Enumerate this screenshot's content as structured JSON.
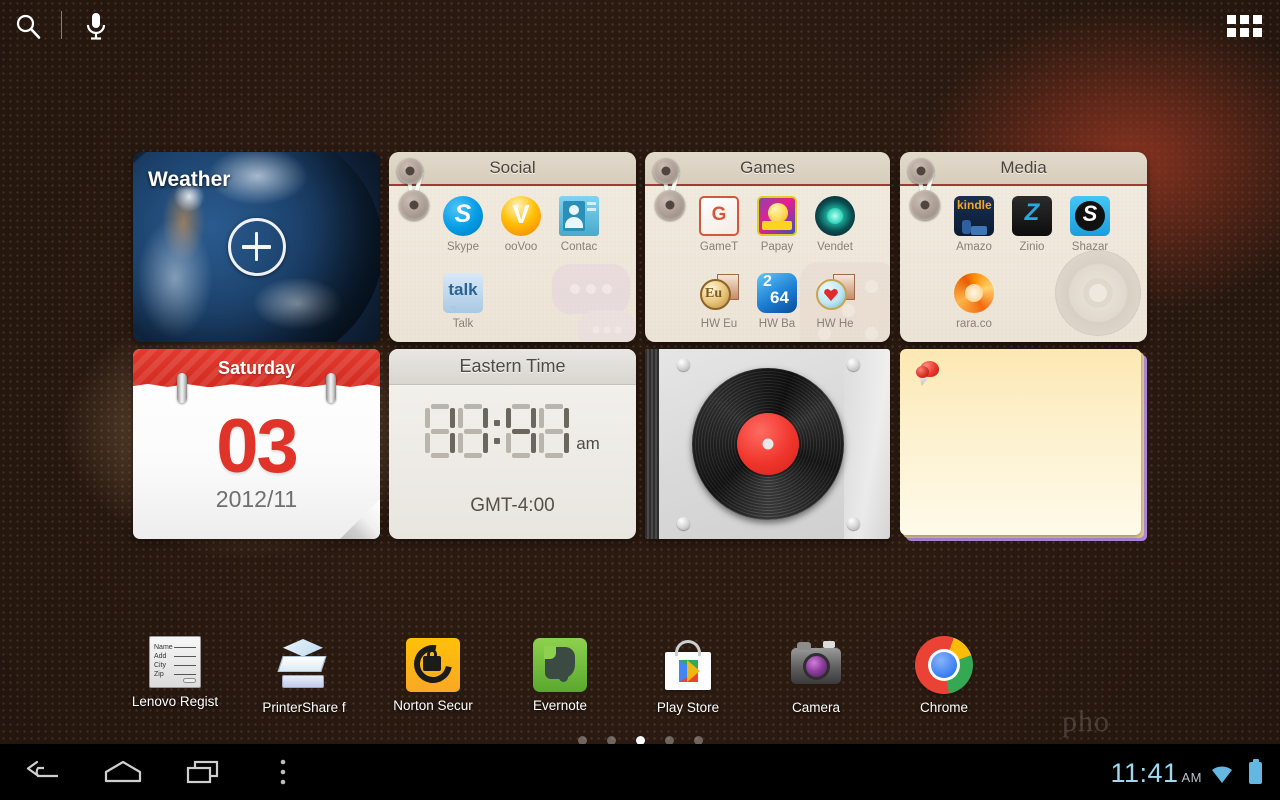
{
  "topbar": {
    "search_icon": "search-icon",
    "mic_icon": "microphone-icon",
    "apps_icon": "apps-grid-icon"
  },
  "widgets": {
    "weather": {
      "title": "Weather",
      "add_icon": "plus-circle-icon"
    },
    "social": {
      "title": "Social",
      "apps": [
        {
          "label": "Skype",
          "icon": "skype-icon"
        },
        {
          "label": "ooVoo",
          "icon": "oovoo-icon"
        },
        {
          "label": "Contac",
          "icon": "contacts-icon"
        },
        {
          "label": "Talk",
          "icon": "google-talk-icon"
        }
      ]
    },
    "games": {
      "title": "Games",
      "apps": [
        {
          "label": "GameT",
          "icon": "gameloft-box-icon"
        },
        {
          "label": "Papay",
          "icon": "papaya-icon"
        },
        {
          "label": "Vendet",
          "icon": "vendetta-icon"
        },
        {
          "label": "HW Eu",
          "icon": "hardwood-euchre-icon"
        },
        {
          "label": "HW Ba",
          "icon": "hardwood-backgammon-icon"
        },
        {
          "label": "HW He",
          "icon": "hardwood-hearts-icon"
        }
      ]
    },
    "media": {
      "title": "Media",
      "apps": [
        {
          "label": "Amazo",
          "icon": "kindle-icon"
        },
        {
          "label": "Zinio",
          "icon": "zinio-icon"
        },
        {
          "label": "Shazar",
          "icon": "shazam-icon"
        },
        {
          "label": "rara.co",
          "icon": "rara-icon"
        }
      ]
    },
    "calendar": {
      "weekday": "Saturday",
      "day": "03",
      "year_month": "2012/11"
    },
    "clock": {
      "zone_label": "Eastern Time",
      "time": "11:41",
      "meridiem": "am",
      "gmt_offset": "GMT-4:00",
      "digits": [
        "1",
        "1",
        "4",
        "1"
      ]
    },
    "music": {
      "name": "vinyl-record-widget"
    },
    "note": {
      "name": "sticky-note-widget",
      "text": ""
    }
  },
  "dock": [
    {
      "label": "Lenovo Regist",
      "icon": "lenovo-registration-icon"
    },
    {
      "label": "PrinterShare f",
      "icon": "printershare-icon"
    },
    {
      "label": "Norton Secur",
      "icon": "norton-security-icon"
    },
    {
      "label": "Evernote",
      "icon": "evernote-icon"
    },
    {
      "label": "Play Store",
      "icon": "play-store-icon"
    },
    {
      "label": "Camera",
      "icon": "camera-icon"
    },
    {
      "label": "Chrome",
      "icon": "chrome-icon"
    }
  ],
  "page_indicator": {
    "count": 5,
    "active_index": 2
  },
  "system_bar": {
    "back_icon": "back-icon",
    "home_icon": "home-icon",
    "recents_icon": "recent-apps-icon",
    "menu_icon": "menu-overflow-icon",
    "time": "11:41",
    "meridiem": "AM",
    "wifi_icon": "wifi-icon",
    "battery_icon": "battery-full-icon"
  },
  "wallpaper": {
    "watermark": "pho",
    "accent": "#b8794c"
  }
}
